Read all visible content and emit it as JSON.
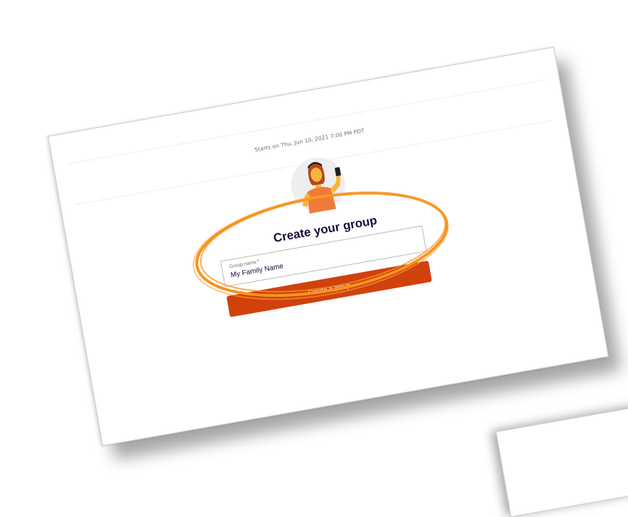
{
  "event": {
    "starts_text": "Starts on Thu, Jun 10, 2021 7:00 PM PDT"
  },
  "avatar": {
    "icon": "person-holding-phone-illustration"
  },
  "form": {
    "title": "Create your group",
    "group_name_label": "Group name",
    "required_marker": "*",
    "group_name_value": "My Family Name",
    "submit_label": "Create a group"
  },
  "highlight": {
    "color": "#f7931e"
  },
  "colors": {
    "brand_button": "#d1410c",
    "title_text": "#1e0a3c"
  }
}
